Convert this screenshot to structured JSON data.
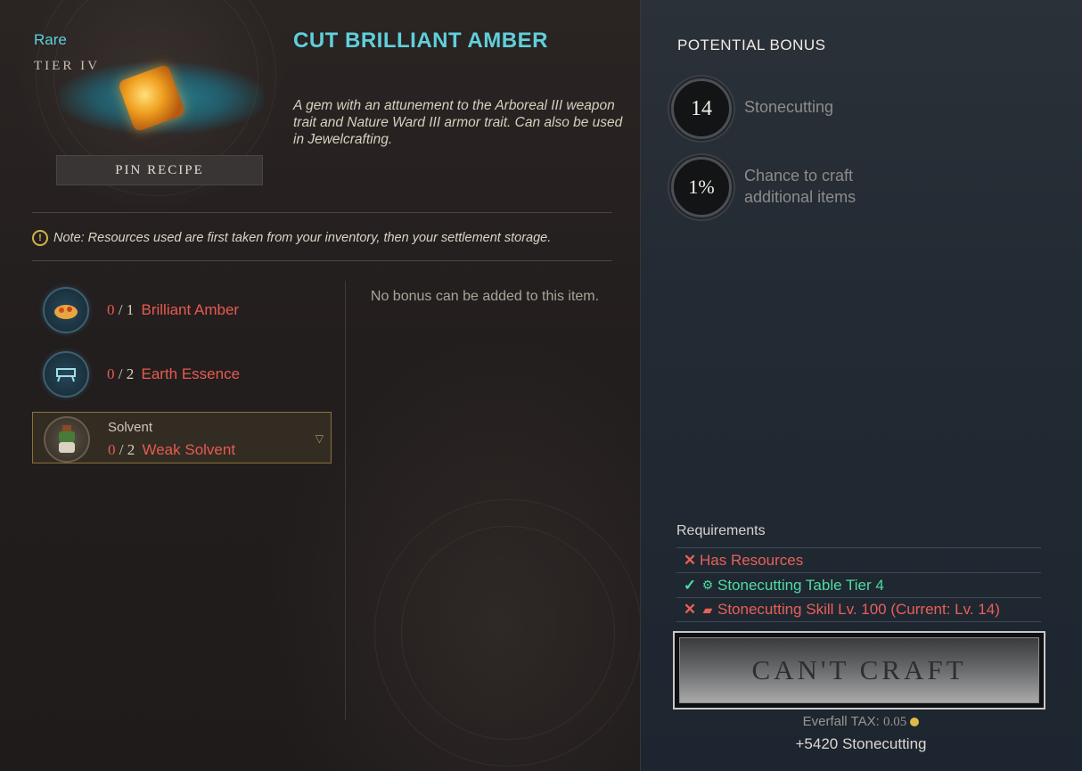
{
  "item": {
    "rarity": "Rare",
    "tier": "TIER IV",
    "title": "CUT BRILLIANT AMBER",
    "description": "A gem with an attunement to the Arboreal III weapon trait and Nature Ward III armor trait. Can also be used in Jewelcrafting.",
    "pin_label": "PIN RECIPE",
    "icon": "amber-gem-icon"
  },
  "note": {
    "icon": "!",
    "text": "Note: Resources used are first taken from your inventory, then your settlement storage."
  },
  "ingredients": [
    {
      "have": "0",
      "sep": "/",
      "need": "1",
      "name": "Brilliant Amber",
      "icon": "amber-ore-icon"
    },
    {
      "have": "0",
      "sep": "/",
      "need": "2",
      "name": "Earth Essence",
      "icon": "earth-essence-icon"
    },
    {
      "label": "Solvent",
      "have": "0",
      "sep": "/",
      "need": "2",
      "name": "Weak Solvent",
      "icon": "solvent-icon",
      "selected": true
    }
  ],
  "no_bonus_text": "No bonus can be added to this item.",
  "potential_bonus": {
    "title": "POTENTIAL BONUS",
    "items": [
      {
        "value": "14",
        "label": "Stonecutting"
      },
      {
        "value": "1%",
        "label": "Chance to craft additional items"
      }
    ]
  },
  "requirements": {
    "title": "Requirements",
    "rows": [
      {
        "status": "fail",
        "mark": "✕",
        "sub_icon": "",
        "text": "Has Resources"
      },
      {
        "status": "pass",
        "mark": "✓",
        "sub_icon": "⚙",
        "text": "Stonecutting Table Tier 4"
      },
      {
        "status": "fail",
        "mark": "✕",
        "sub_icon": "▰",
        "text": "Stonecutting Skill Lv. 100 (Current: Lv. 14)"
      }
    ]
  },
  "craft": {
    "label": "CAN'T CRAFT",
    "tax_label": "Everfall TAX:",
    "tax_value": "0.05",
    "xp_gain": "+5420 Stonecutting"
  },
  "colors": {
    "accent": "#5fd0db",
    "fail": "#e86058",
    "pass": "#4fdca2"
  }
}
